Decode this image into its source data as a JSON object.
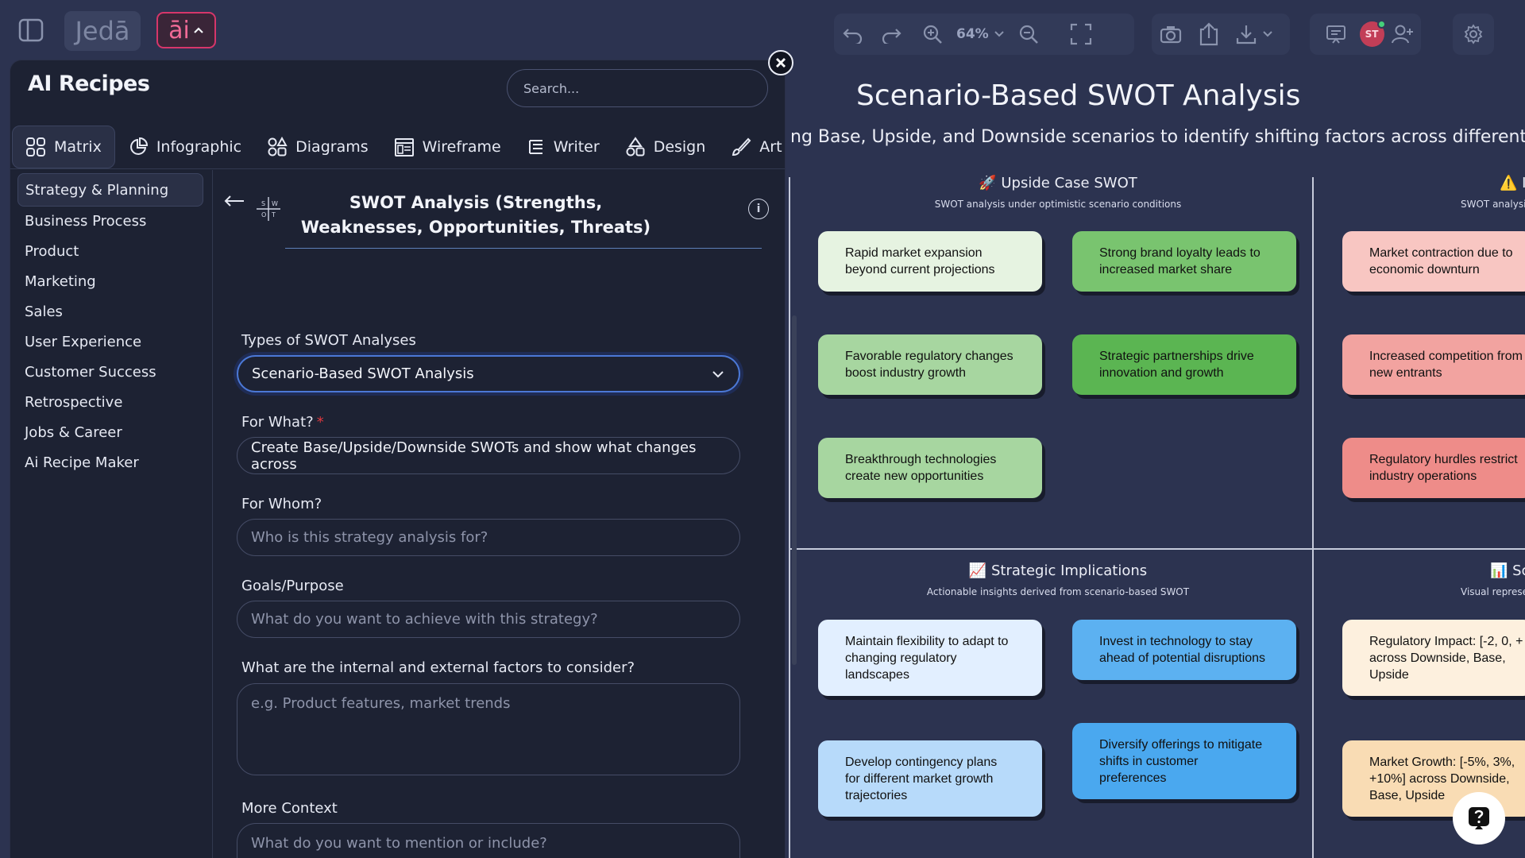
{
  "app": {
    "logo_text": "Jedā",
    "ai_label": "āi"
  },
  "toolbar": {
    "zoom": "64%"
  },
  "user": {
    "initials": "ST"
  },
  "panel": {
    "title": "AI Recipes",
    "search_placeholder": "Search...",
    "tabs": [
      {
        "label": "Matrix",
        "icon": "matrix-icon"
      },
      {
        "label": "Infographic",
        "icon": "infographic-icon"
      },
      {
        "label": "Diagrams",
        "icon": "diagrams-icon"
      },
      {
        "label": "Wireframe",
        "icon": "wireframe-icon"
      },
      {
        "label": "Writer",
        "icon": "writer-icon"
      },
      {
        "label": "Design",
        "icon": "design-icon"
      },
      {
        "label": "Art",
        "icon": "art-icon"
      }
    ],
    "categories": [
      "Strategy & Planning",
      "Business Process",
      "Product",
      "Marketing",
      "Sales",
      "User Experience",
      "Customer Success",
      "Retrospective",
      "Jobs & Career",
      "Ai Recipe Maker"
    ]
  },
  "form": {
    "recipe_title": "SWOT Analysis (Strengths, Weaknesses, Opportunities, Threats)",
    "swot_icon_letters": [
      "S",
      "W",
      "O",
      "T"
    ],
    "type_label": "Types of SWOT Analyses",
    "type_value": "Scenario-Based SWOT Analysis",
    "what_label": "For What?",
    "what_value": "Create Base/Upside/Downside SWOTs and show what changes across",
    "whom_label": "For Whom?",
    "whom_placeholder": "Who is this strategy analysis for?",
    "goals_label": "Goals/Purpose",
    "goals_placeholder": "What do you want to achieve with this strategy?",
    "factors_label": "What are the internal and external factors to consider?",
    "factors_placeholder": "e.g. Product features, market trends",
    "context_label": "More Context",
    "context_placeholder": "What do you want to mention or include?"
  },
  "canvas": {
    "title": "Scenario-Based SWOT Analysis",
    "subtitle": "ng Base, Upside, and Downside scenarios to identify shifting factors across different poten",
    "upside": {
      "title": "🚀 Upside Case SWOT",
      "subtitle": "SWOT analysis under optimistic scenario conditions",
      "cards": [
        "Rapid market expansion\nbeyond current projections",
        "Strong brand loyalty leads to\nincreased market share",
        "Favorable regulatory changes\nboost industry growth",
        "Strategic partnerships drive\ninnovation and growth",
        "Breakthrough technologies\ncreate new opportunities"
      ]
    },
    "downside": {
      "title": "⚠️ I",
      "subtitle": "SWOT analysis",
      "cards": [
        "Market contraction due to\neconomic downturn",
        "Increased competition from\nnew entrants",
        "Regulatory hurdles restrict\nindustry operations"
      ]
    },
    "implications": {
      "title": "📈 Strategic Implications",
      "subtitle": "Actionable insights derived from scenario-based SWOT",
      "cards": [
        "Maintain flexibility to adapt to\nchanging regulatory\nlandscapes",
        "Invest in technology to stay\nahead of potential disruptions",
        "Develop contingency plans\nfor different market growth\ntrajectories",
        "Diversify offerings to mitigate\nshifts in customer\npreferences"
      ]
    },
    "visual": {
      "title": "📊 Sc",
      "subtitle": "Visual represe",
      "cards": [
        "Regulatory Impact: [-2, 0, +\nacross Downside, Base,\nUpside",
        "Market Growth: [-5%, 3%,\n+10%] across Downside,\nBase, Upside"
      ]
    },
    "colors": {
      "green_light": "#e6f3e1",
      "green_mid": "#a7d6a0",
      "green_strong": "#79c46f",
      "green_bright": "#5bb552",
      "pink_light": "#f8c6c2",
      "pink_mid": "#f2a3a0",
      "pink_strong": "#ee8c89",
      "blue_light": "#e2efff",
      "blue_mid": "#b7dafa",
      "blue_strong": "#5cb1f1",
      "blue_bright": "#4aa8ef",
      "cream_light": "#fdf0de",
      "cream_mid": "#f9dcb4"
    }
  }
}
